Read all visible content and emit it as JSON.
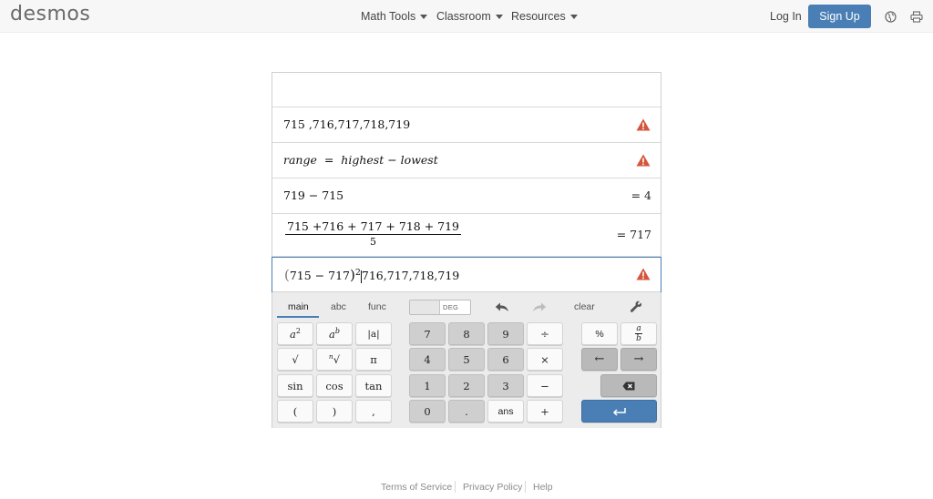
{
  "header": {
    "logo": "desmos",
    "nav": [
      {
        "label": "Math Tools"
      },
      {
        "label": "Classroom"
      },
      {
        "label": "Resources"
      }
    ],
    "login": "Log In",
    "signup": "Sign Up",
    "icons": [
      "globe-icon",
      "print-icon"
    ]
  },
  "expressions": {
    "e2": {
      "text": "715 ,716,717,718,719",
      "warning": true
    },
    "e3": {
      "lhs": "range",
      "eq": "=",
      "a": "highest",
      "minus": "−",
      "b": "lowest",
      "warning": true
    },
    "e4": {
      "text": "719 − 715",
      "result": "= 4"
    },
    "e5": {
      "numerator": "715 +716 + 717 + 718 + 719",
      "denominator": "5",
      "result": "= 717"
    },
    "e6": {
      "open": "(",
      "inner": "715 − 717",
      "close": ")",
      "exp": "2",
      "tail": "716,717,718,719",
      "warning": true
    }
  },
  "keypad": {
    "tabs": [
      "main",
      "abc",
      "func"
    ],
    "active_tab": "main",
    "angle_mode": "DEG",
    "clear": "clear",
    "keys": {
      "a_sq": "a",
      "a_sq_exp": "2",
      "a_b": "a",
      "a_b_exp": "b",
      "abs": "|a|",
      "sqrt": "√",
      "nroot_idx": "n",
      "nroot": "√",
      "pi": "π",
      "sin": "sin",
      "cos": "cos",
      "tan": "tan",
      "lparen": "(",
      "rparen": ")",
      "comma": ",",
      "n7": "7",
      "n8": "8",
      "n9": "9",
      "div": "÷",
      "n4": "4",
      "n5": "5",
      "n6": "6",
      "mul": "×",
      "n1": "1",
      "n2": "2",
      "n3": "3",
      "sub": "−",
      "n0": "0",
      "dot": ".",
      "ans": "ans",
      "add": "+",
      "pct": "%",
      "frac_num": "a",
      "frac_den": "b",
      "left": "←",
      "right": "→"
    }
  },
  "footer": {
    "links": [
      "Terms of Service",
      "Privacy Policy",
      "Help"
    ]
  },
  "colors": {
    "accent": "#4a7fb5",
    "warning": "#d4553b",
    "header_bg": "#f7f7f7"
  }
}
